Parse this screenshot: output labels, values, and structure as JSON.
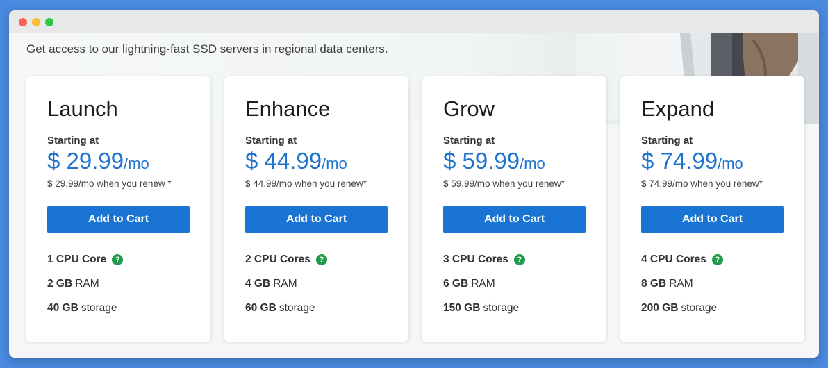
{
  "subtitle": "Get access to our lightning-fast SSD servers in regional data centers.",
  "colors": {
    "accent": "#1a74d3",
    "price": "#1e73cf",
    "help_badge": "#1e9c4a"
  },
  "plans": [
    {
      "name": "Launch",
      "starting_label": "Starting at",
      "price": "$ 29.99",
      "per": "/mo",
      "renew": "$ 29.99/mo when you renew *",
      "button": "Add to Cart",
      "cpu_value": "1 CPU Core",
      "ram_value": "2 GB",
      "ram_unit": "RAM",
      "storage_value": "40 GB",
      "storage_unit": "storage",
      "help": "?"
    },
    {
      "name": "Enhance",
      "starting_label": "Starting at",
      "price": "$ 44.99",
      "per": "/mo",
      "renew": "$ 44.99/mo when you renew*",
      "button": "Add to Cart",
      "cpu_value": "2 CPU Cores",
      "ram_value": "4 GB",
      "ram_unit": "RAM",
      "storage_value": "60 GB",
      "storage_unit": "storage",
      "help": "?"
    },
    {
      "name": "Grow",
      "starting_label": "Starting at",
      "price": "$ 59.99",
      "per": "/mo",
      "renew": "$ 59.99/mo when you renew*",
      "button": "Add to Cart",
      "cpu_value": "3 CPU Cores",
      "ram_value": "6 GB",
      "ram_unit": "RAM",
      "storage_value": "150 GB",
      "storage_unit": "storage",
      "help": "?"
    },
    {
      "name": "Expand",
      "starting_label": "Starting at",
      "price": "$ 74.99",
      "per": "/mo",
      "renew": "$ 74.99/mo when you renew*",
      "button": "Add to Cart",
      "cpu_value": "4 CPU Cores",
      "ram_value": "8 GB",
      "ram_unit": "RAM",
      "storage_value": "200 GB",
      "storage_unit": "storage",
      "help": "?"
    }
  ]
}
